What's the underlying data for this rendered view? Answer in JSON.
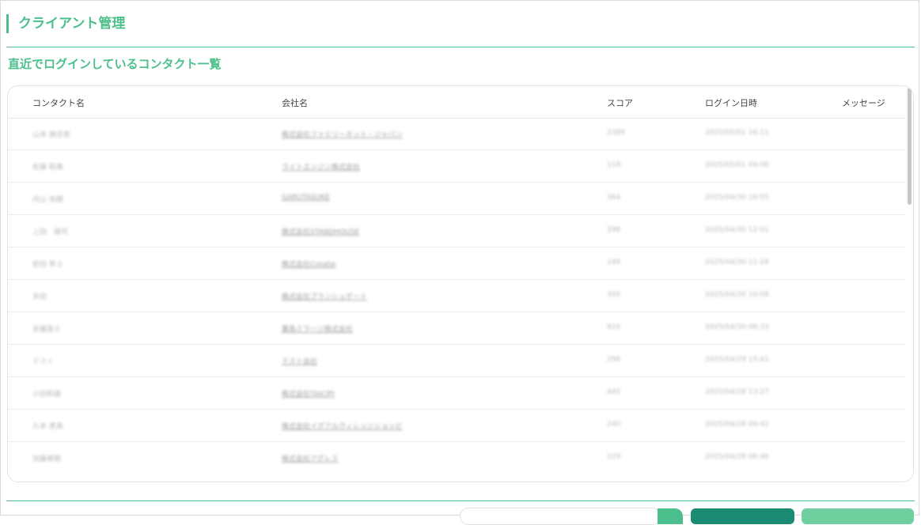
{
  "page": {
    "title": "クライアント管理"
  },
  "section": {
    "title": "直近でログインしているコンタクト一覧"
  },
  "table": {
    "columns": {
      "contact": "コンタクト名",
      "company": "会社名",
      "score": "スコア",
      "login": "ログイン日時",
      "message": "メッセージ"
    },
    "rows": [
      {
        "contact": "山本 美佳恵",
        "company": "株式会社ファミリーネット・ジャパン",
        "score": "2389",
        "login": "2025/05/01 16:11"
      },
      {
        "contact": "佐藤 聡美",
        "company": "ライトエンジン株式会社",
        "score": "119",
        "login": "2025/05/01 09:06"
      },
      {
        "contact": "内山 祐樹",
        "company": "GARUTASUKE",
        "score": "364",
        "login": "2025/04/30 16:55"
      },
      {
        "contact": "上田　健司",
        "company": "株式会社STANDHOUSE",
        "score": "298",
        "login": "2025/04/30 12:01"
      },
      {
        "contact": "前田 隼士",
        "company": "株式会社Creatie",
        "score": "189",
        "login": "2025/04/30 11:28"
      },
      {
        "contact": "多田",
        "company": "株式会社ブランシュゲート",
        "score": "305",
        "login": "2025/04/30 10:08"
      },
      {
        "contact": "安藤直士",
        "company": "薬島ミラージ株式会社",
        "score": "810",
        "login": "2025/04/30 08:33"
      },
      {
        "contact": "テスト",
        "company": "テスト会社",
        "score": "296",
        "login": "2025/04/29 15:41"
      },
      {
        "contact": "小田和雄",
        "company": "株式会社TAICIPI",
        "score": "445",
        "login": "2025/04/28 13:27"
      },
      {
        "contact": "久本 勇真",
        "company": "株式会社イグアルヴィレッジショッピ",
        "score": "240",
        "login": "2025/04/28 09:42"
      },
      {
        "contact": "加藤美樹",
        "company": "株式会社アグレス",
        "score": "229",
        "login": "2025/04/28 06:46"
      }
    ]
  },
  "colors": {
    "accent": "#4cbf8c",
    "dark_button": "#1a8a72",
    "light_button": "#6fcf9f"
  }
}
